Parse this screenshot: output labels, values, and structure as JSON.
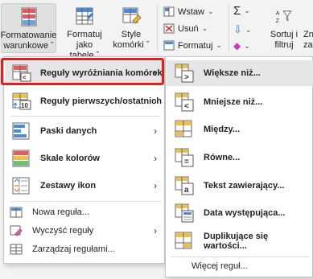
{
  "ribbon": {
    "format_warunkowe_l1": "Formatowanie",
    "format_warunkowe_l2": "warunkowe ˇ",
    "format_tabela_l1": "Formatuj jako",
    "format_tabela_l2": "tabelę ˇ",
    "style_l1": "Style",
    "style_l2": "komórki ˇ",
    "wstaw": "Wstaw",
    "usun": "Usuń",
    "formatuj": "Formatuj",
    "sortuj_l1": "Sortuj i",
    "sortuj_l2": "filtruj",
    "cut_l1": "Zn",
    "cut_l2": "zazn"
  },
  "menu": {
    "items": [
      {
        "label": "Reguły wyróżniania komórek"
      },
      {
        "label": "Reguły pierwszych/ostatnich"
      },
      {
        "label": "Paski danych"
      },
      {
        "label": "Skale kolorów"
      },
      {
        "label": "Zestawy ikon"
      }
    ],
    "nowa": "Nowa reguła...",
    "wyczysc": "Wyczyść reguły",
    "zarzadzaj": "Zarządzaj regułami..."
  },
  "submenu": {
    "items": [
      {
        "label": "Większe niż..."
      },
      {
        "label": "Mniejsze niż..."
      },
      {
        "label": "Między..."
      },
      {
        "label": "Równe..."
      },
      {
        "label": "Tekst zawierający..."
      },
      {
        "label": "Data występująca..."
      },
      {
        "label": "Duplikujące się wartości..."
      }
    ],
    "more": "Więcej reguł..."
  },
  "colors": {
    "highlight": "#e02020",
    "accent": "#2b6fd1"
  }
}
